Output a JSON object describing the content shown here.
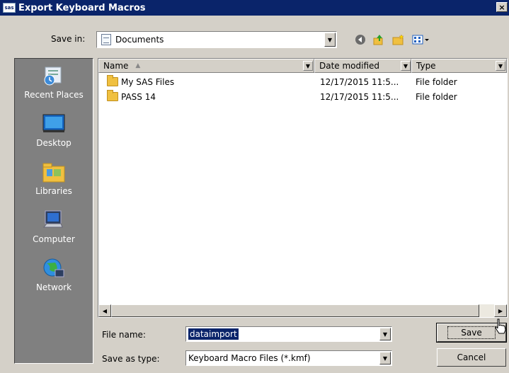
{
  "window": {
    "title": "Export Keyboard Macros",
    "icon_text": "sas",
    "close_label": "×"
  },
  "savein": {
    "label": "Save in:",
    "value": "Documents"
  },
  "toolbar": {
    "icons": [
      "back-icon",
      "up-folder-icon",
      "new-folder-icon",
      "views-menu-icon"
    ]
  },
  "places": [
    {
      "label": "Recent Places",
      "icon": "recent-places-icon"
    },
    {
      "label": "Desktop",
      "icon": "desktop-icon"
    },
    {
      "label": "Libraries",
      "icon": "libraries-icon"
    },
    {
      "label": "Computer",
      "icon": "computer-icon"
    },
    {
      "label": "Network",
      "icon": "network-icon"
    }
  ],
  "file_list": {
    "columns": [
      "Name",
      "Date modified",
      "Type"
    ],
    "rows": [
      {
        "name": "My SAS Files",
        "date": "12/17/2015 11:5...",
        "type": "File folder"
      },
      {
        "name": "PASS 14",
        "date": "12/17/2015 11:5...",
        "type": "File folder"
      }
    ]
  },
  "filename": {
    "label": "File name:",
    "value": "dataimport"
  },
  "savetype": {
    "label": "Save as type:",
    "value": "Keyboard Macro Files (*.kmf)"
  },
  "buttons": {
    "save": "Save",
    "cancel": "Cancel"
  },
  "colors": {
    "title_bar": "#0a246a",
    "dialog_bg": "#d4d0c8",
    "places_bg": "#808080"
  }
}
